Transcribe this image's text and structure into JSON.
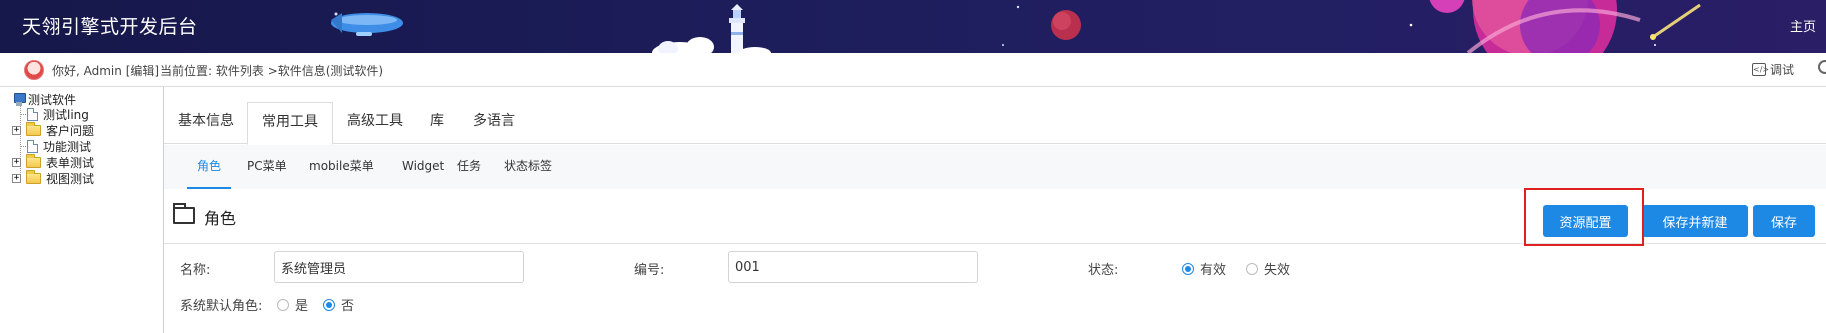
{
  "header": {
    "app_title": "天翎引擎式开发后台",
    "home_label": "主页"
  },
  "infobar": {
    "greeting": "你好, Admin",
    "edit_label": "[编辑]",
    "location_prefix": "当前位置:",
    "location_path": "软件列表 >软件信息(测试软件)",
    "debug_label": "调试"
  },
  "tree": {
    "root": "测试软件",
    "items": [
      "测试ling",
      "客户问题",
      "功能测试",
      "表单测试",
      "视图测试"
    ]
  },
  "tabs": [
    "基本信息",
    "常用工具",
    "高级工具",
    "库",
    "多语言"
  ],
  "active_tab": "常用工具",
  "subtabs": [
    "角色",
    "PC菜单",
    "mobile菜单",
    "Widget",
    "任务",
    "状态标签"
  ],
  "active_subtab": "角色",
  "section": {
    "title": "角色",
    "buttons": {
      "resource_config": "资源配置",
      "save_and_new": "保存并新建",
      "save": "保存"
    }
  },
  "form": {
    "name_label": "名称:",
    "name_value": "系统管理员",
    "code_label": "编号:",
    "code_value": "001",
    "status_label": "状态:",
    "status_options": [
      "有效",
      "失效"
    ],
    "status_selected": "有效",
    "default_role_label": "系统默认角色:",
    "default_role_options": [
      "是",
      "否"
    ],
    "default_role_selected": "否"
  },
  "colors": {
    "header_bg": "#1c1d5a",
    "accent": "#1e88e5",
    "highlight": "#e02020"
  }
}
